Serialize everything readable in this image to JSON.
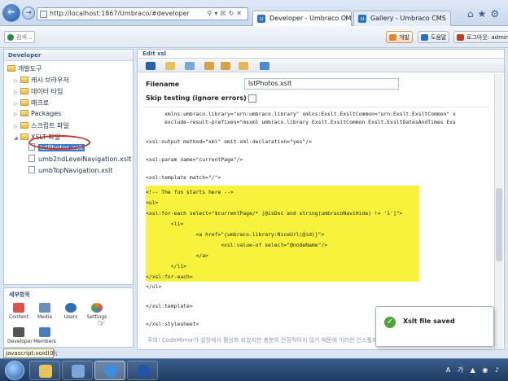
{
  "browser": {
    "url": "http://localhost:1867/Umbraco/#developer",
    "tabs": [
      {
        "label": "Developer - Umbraco CMS"
      },
      {
        "label": "Gallery - Umbraco CMS"
      }
    ]
  },
  "topbar": {
    "search_placeholder": "검색...",
    "help_label": "도움말",
    "logout_label": "로그아웃: admin",
    "active_label": "개발"
  },
  "tree": {
    "header": "Developer",
    "items": [
      {
        "label": "개발도구",
        "kind": "folder"
      },
      {
        "label": "캐시 브라우저",
        "kind": "folder"
      },
      {
        "label": "데이터 타입",
        "kind": "folder"
      },
      {
        "label": "매크로",
        "kind": "folder"
      },
      {
        "label": "Packages",
        "kind": "folder"
      },
      {
        "label": "스크립트 파일",
        "kind": "folder"
      },
      {
        "label": "XSLT 파일",
        "kind": "folder"
      },
      {
        "label": "lstPhotos.xslt",
        "kind": "file",
        "selected": true
      },
      {
        "label": "umb2ndLevelNavigation.xslt",
        "kind": "file"
      },
      {
        "label": "umbTopNavigation.xslt",
        "kind": "file"
      }
    ]
  },
  "sections": {
    "header": "세부항목",
    "items": [
      {
        "label": "Content",
        "color": "#d9534f"
      },
      {
        "label": "Media",
        "color": "#6c8ebf"
      },
      {
        "label": "Users",
        "color": "#2f6db5"
      },
      {
        "label": "Settings",
        "color": "#e08a2e"
      },
      {
        "label": "Developer",
        "color": "#555555"
      },
      {
        "label": "Members",
        "color": "#4a7fbf"
      }
    ]
  },
  "status_bar": "javascript:void(0);",
  "editor": {
    "header": "Edit xsl",
    "filename_label": "Filename",
    "filename_value": "lstPhotos.xslt",
    "skip_testing_label": "Skip testing (ignore errors)",
    "code_lines": [
      "      xmlns:umbraco.library=\"urn:umbraco.library\" xmlns:Exslt.ExsltCommon=\"urn:Exslt.ExsltCommon\" x",
      "      exclude-result-prefixes=\"msxml umbraco.library Exslt.ExsltCommon Exslt.ExsltDatesAndTimes Exs",
      "",
      "<xsl:output method=\"xml\" omit-xml-declaration=\"yes\"/>",
      "",
      "<xsl:param name=\"currentPage\"/>",
      "",
      "<xsl:template match=\"/\">",
      "",
      "<!-- The fun starts here -->",
      "<ul>",
      "<xsl:for-each select=\"$currentPage/* [@isDoc and string(umbracoNaviHide) != '1']\">",
      "        <li>",
      "                <a href=\"{umbraco.library:NiceUrl(@id)}\">",
      "                        <xsl:value-of select=\"@nodeName\"/>",
      "                </a>",
      "        </li>",
      "</xsl:for-each>",
      "</ul>",
      "",
      "</xsl:template>",
      "",
      "</xsl:stylesheet>"
    ],
    "footer_note": "주의! CodeMirror가 설정에서 활성화 되었지만 충분히 안정적이지 않기 때문에 이러한 인스톨되었다. 예제들은 입니다."
  },
  "toast": {
    "message": "Xslt file saved"
  },
  "colors": {
    "highlight": "#f7f33a",
    "selected": "#3b7bd1",
    "annotation": "#c0392b"
  }
}
